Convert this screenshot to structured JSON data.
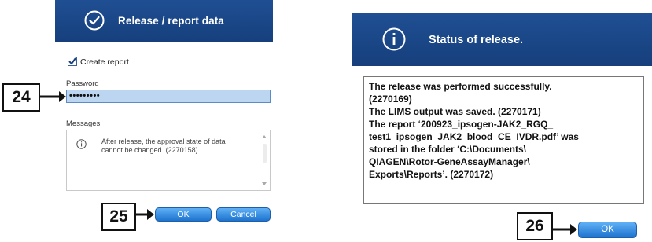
{
  "left_dialog": {
    "title": "Release / report data",
    "create_report_label": "Create report",
    "create_report_checked": true,
    "password_label": "Password",
    "password_value": "•••••••••",
    "messages_label": "Messages",
    "messages": [
      "After release, the approval state of data",
      "cannot be changed. (2270158)"
    ],
    "ok_label": "OK",
    "cancel_label": "Cancel"
  },
  "right_dialog": {
    "title": "Status of release.",
    "report_lines": [
      "The release was performed successfully.",
      "(2270169)",
      "The LIMS output was saved. (2270171)",
      "The report ‘200923_ipsogen-JAK2_RGQ_",
      "test1_ipsogen_JAK2_blood_CE_IVDR.pdf’ was",
      "stored in the folder ‘C:\\Documents\\",
      "QIAGEN\\Rotor-GeneAssayManager\\",
      "Exports\\Reports’. (2270172)"
    ],
    "ok_label": "OK"
  },
  "callouts": {
    "step_24": "24",
    "step_25": "25",
    "step_26": "26"
  },
  "colors": {
    "title_bar": "#1a4788",
    "button": "#2a86e0",
    "password_field": "#bcd6f2"
  }
}
